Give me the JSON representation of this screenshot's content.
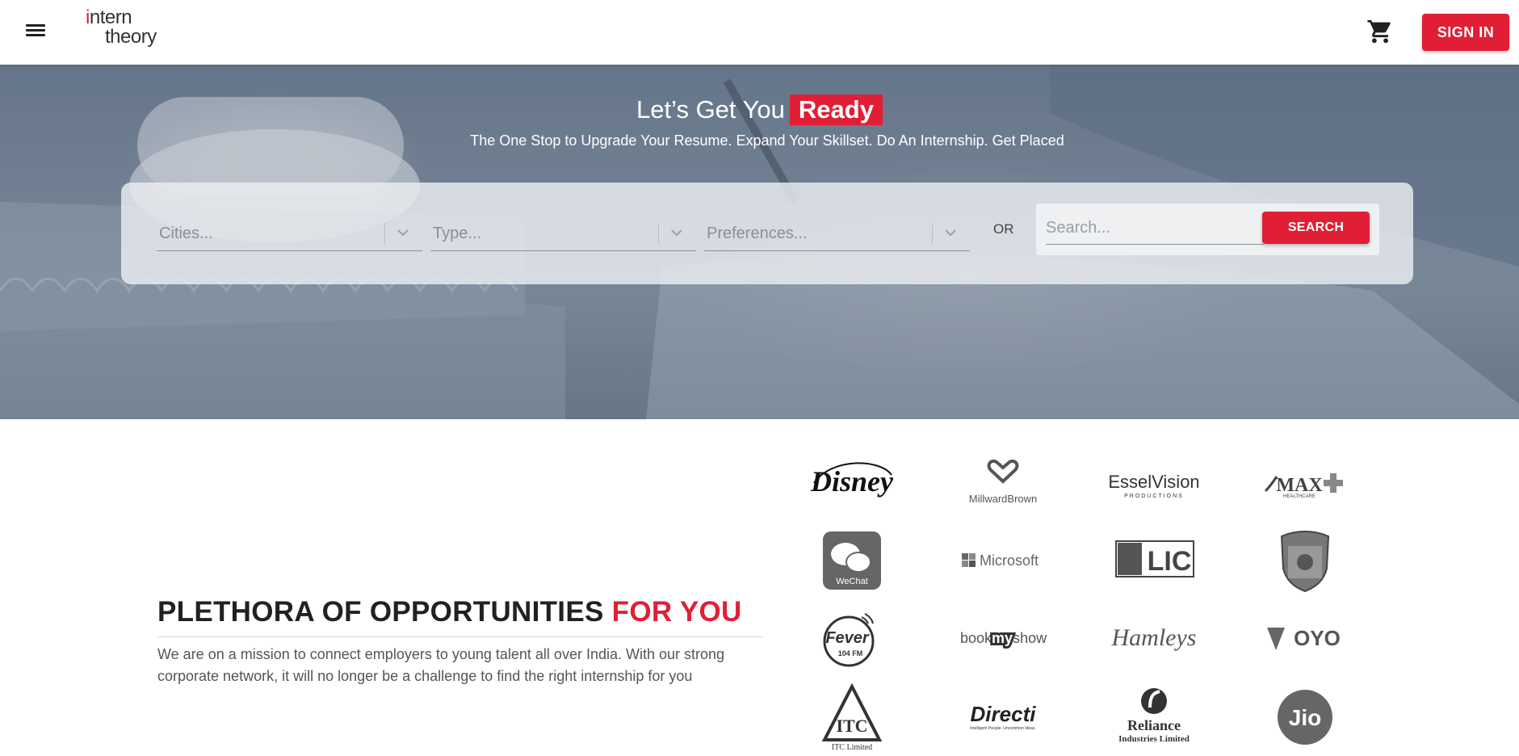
{
  "header": {
    "menu_icon": "hamburger-menu-icon",
    "logo": {
      "line1_prefix": "i",
      "line1_rest": "ntern",
      "line2": "theory"
    },
    "cart_icon": "shopping-cart-icon",
    "signin_label": "SIGN IN",
    "accent_color": "#e01f35"
  },
  "hero": {
    "title_prefix": "Let’s Get You",
    "title_highlight": "Ready",
    "subtitle": "The One Stop to Upgrade Your Resume. Expand Your Skillset. Do An Internship. Get Placed",
    "filters": {
      "cities_placeholder": "Cities...",
      "type_placeholder": "Type...",
      "preferences_placeholder": "Preferences..."
    },
    "or_label": "OR",
    "search_placeholder": "Search...",
    "search_button": "SEARCH"
  },
  "opportunities": {
    "title_main": "PLETHORA OF OPPORTUNITIES",
    "title_accent": "FOR YOU",
    "description": "We are on a mission to connect employers to young talent all over India. With our strong corporate network, it will no longer be a challenge to find the right internship for you"
  },
  "partners": {
    "logos": [
      {
        "name": "Disney",
        "icon": "disney-logo"
      },
      {
        "name": "MillwardBrown",
        "icon": "millwardbrown-logo"
      },
      {
        "name": "EsselVision",
        "sub": "PRODUCTIONS",
        "icon": "esselvision-logo"
      },
      {
        "name": "MAX",
        "sub": "HEALTHCARE",
        "icon": "max-healthcare-logo"
      },
      {
        "name": "WeChat",
        "icon": "wechat-logo"
      },
      {
        "name": "Microsoft",
        "icon": "microsoft-logo"
      },
      {
        "name": "LIC",
        "icon": "lic-logo"
      },
      {
        "name": "Porsche",
        "icon": "porsche-logo"
      },
      {
        "name": "Fever",
        "sub": "104 FM",
        "icon": "fever-fm-logo"
      },
      {
        "name_a": "book",
        "name_b": "my",
        "name_c": "show",
        "icon": "bookmyshow-logo"
      },
      {
        "name": "Hamleys",
        "icon": "hamleys-logo"
      },
      {
        "name": "OYO",
        "icon": "oyo-logo"
      },
      {
        "name": "ITC Limited",
        "icon": "itc-logo"
      },
      {
        "name": "Directi",
        "sub": "Intelligent People. Uncommon Ideas.",
        "icon": "directi-logo"
      },
      {
        "name": "Reliance",
        "sub": "Industries Limited",
        "icon": "reliance-logo"
      },
      {
        "name": "Jio",
        "icon": "jio-logo"
      }
    ]
  }
}
